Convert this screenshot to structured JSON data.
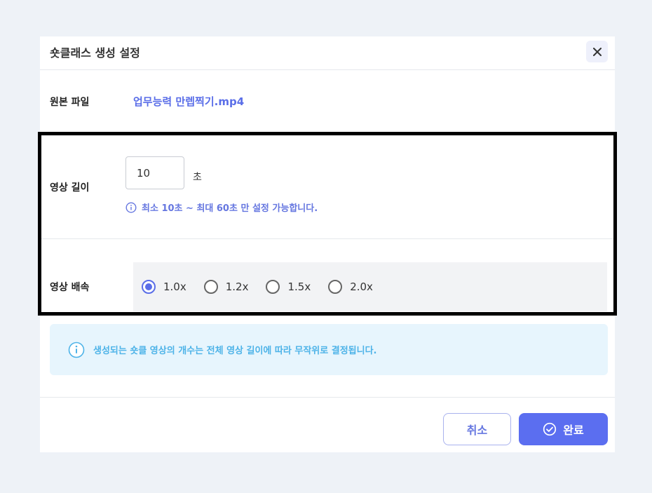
{
  "dialog": {
    "title": "숏클래스 생성 설정",
    "close_icon": "close-icon"
  },
  "source_file": {
    "label": "원본 파일",
    "value": "업무능력 만렙찍기.mp4"
  },
  "video_length": {
    "label": "영상 길이",
    "value": "10",
    "unit": "초",
    "hint": "최소 10초 ~ 최대 60초 만 설정 가능합니다.",
    "hint_icon": "info-icon"
  },
  "video_speed": {
    "label": "영상 배속",
    "options": [
      {
        "label": "1.0x",
        "checked": true
      },
      {
        "label": "1.2x",
        "checked": false
      },
      {
        "label": "1.5x",
        "checked": false
      },
      {
        "label": "2.0x",
        "checked": false
      }
    ]
  },
  "notice": {
    "text": "생성되는 숏클 영상의 개수는 전체 영상 길이에 따라 무작위로 결정됩니다.",
    "icon": "info-icon"
  },
  "footer": {
    "cancel_label": "취소",
    "done_label": "완료",
    "done_icon": "check-circle-icon"
  },
  "colors": {
    "accent": "#5b6ef0",
    "info": "#4db3e8",
    "info_bg": "#e7f5fd",
    "page_bg": "#eef2f7"
  }
}
